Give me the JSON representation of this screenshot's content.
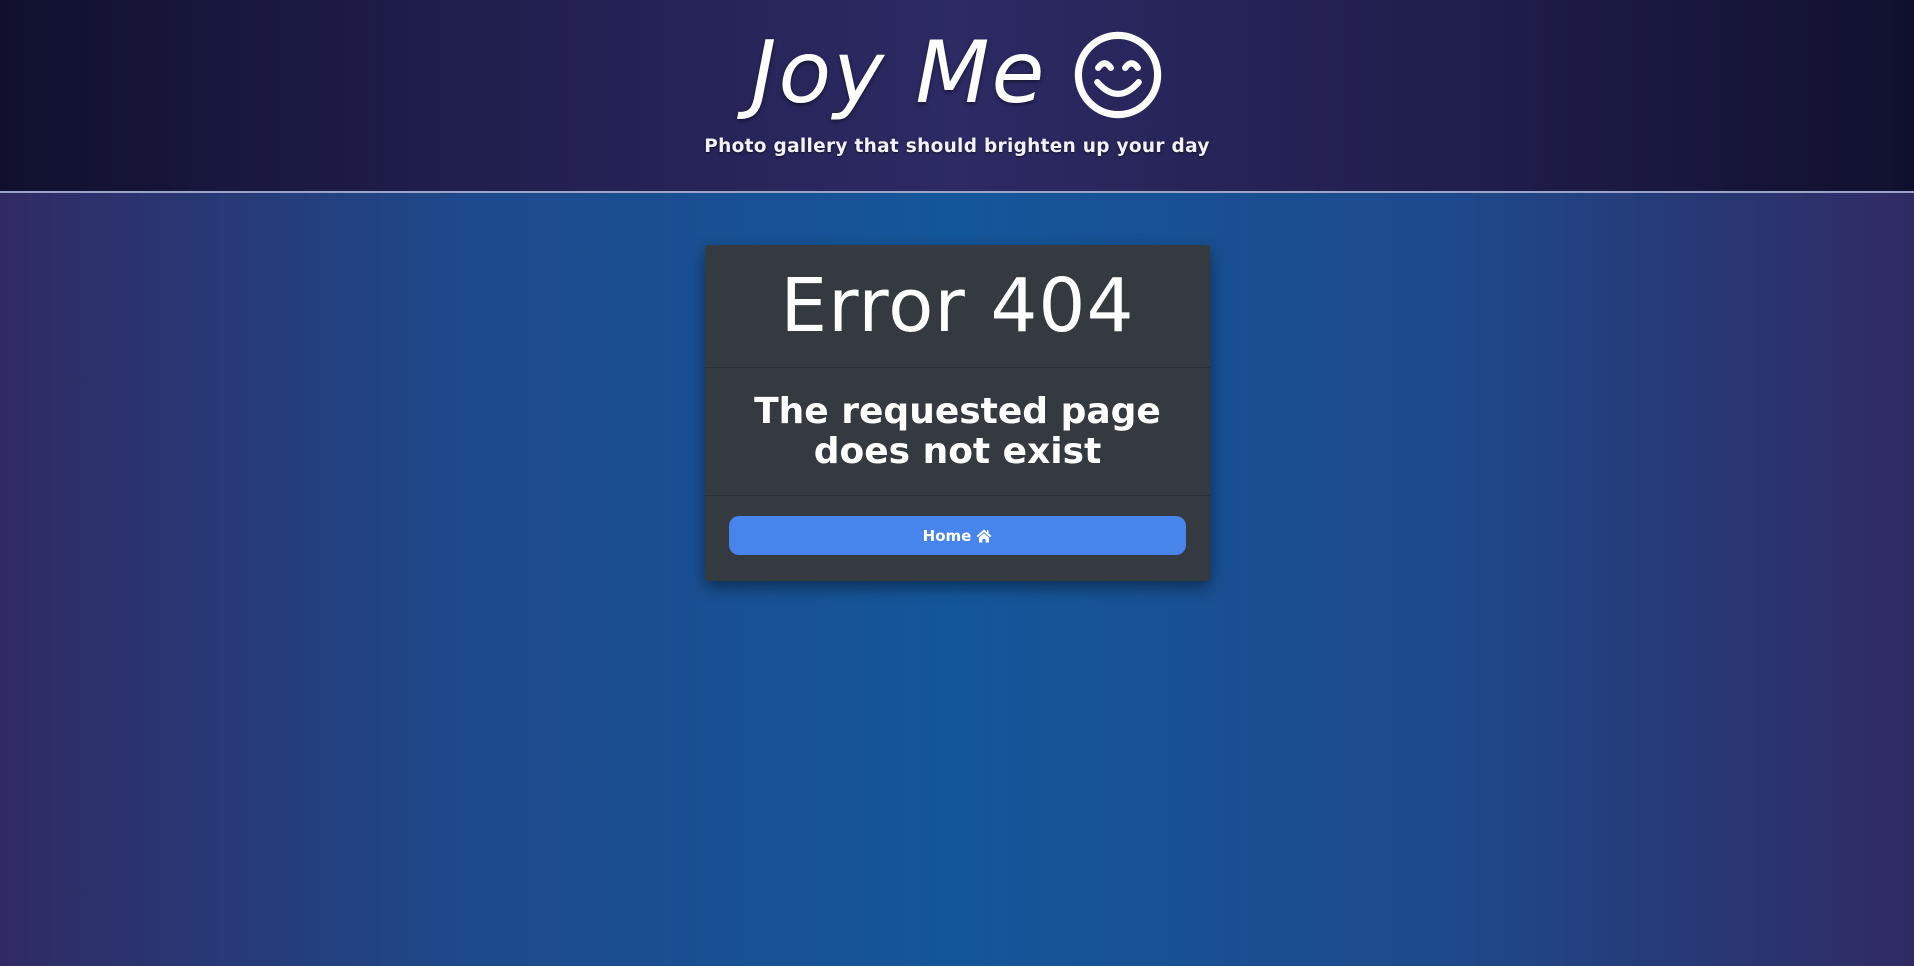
{
  "header": {
    "title": "Joy Me",
    "title_icon": "smiling-face-icon",
    "tagline": "Photo gallery that should brighten up your day"
  },
  "error_card": {
    "heading": "Error 404",
    "message": "The requested page does not exist",
    "home_button": {
      "label": "Home",
      "icon": "home-icon"
    }
  },
  "colors": {
    "header_bg": "#2d2a64",
    "page_bg": "#14569a",
    "card_bg": "#343a40",
    "button_bg": "#4784ec",
    "text": "#ffffff"
  }
}
